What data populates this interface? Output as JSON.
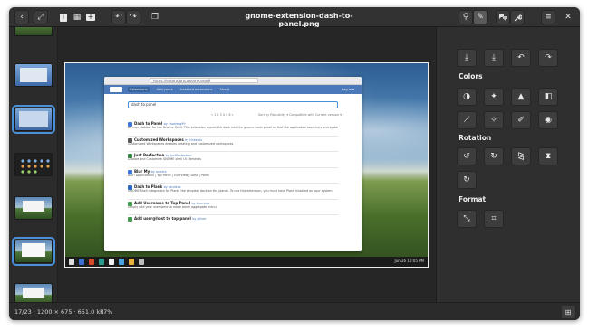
{
  "window": {
    "title": "gnome-extension-dash-to-panel.png"
  },
  "headerbar": {
    "left_buttons": [
      {
        "name": "back-icon",
        "glyph": "‹"
      },
      {
        "name": "fullscreen-icon",
        "glyph": "⤢"
      },
      {
        "name": "info-icon",
        "glyph": "i"
      },
      {
        "name": "gallery-icon",
        "glyph": "▦"
      },
      {
        "name": "add-icon",
        "glyph": "+"
      },
      {
        "name": "rotate-left-icon",
        "glyph": "↶"
      },
      {
        "name": "rotate-right-icon",
        "glyph": "↷"
      },
      {
        "name": "copy-icon",
        "glyph": "❐"
      }
    ],
    "right_buttons": [
      {
        "name": "pin-icon",
        "glyph": "⚲"
      },
      {
        "name": "edit-pencil-icon",
        "glyph": "✎"
      },
      {
        "name": "chat-icon",
        "glyph": "💬"
      },
      {
        "name": "wrench-icon",
        "glyph": "🔧"
      },
      {
        "name": "menu-icon",
        "glyph": "≡"
      }
    ],
    "close_glyph": "✕"
  },
  "browser": {
    "url": "https://extensions.gnome.org/#",
    "nav_items": [
      "Extensions",
      "Add yours",
      "Installed extensions",
      "About"
    ],
    "login": "Log in ▾",
    "search_value": "dash to panel",
    "pager": "« 1 2 3 4 5 6 »",
    "filters": "Sort by  Popularity ▾   Compatible with  Current version ▾",
    "extensions": [
      {
        "name": "Dash to Panel",
        "author": "by charlesg99",
        "desc": "An icon taskbar for the Gnome Shell. This extension moves the dash into the gnome main panel so that the application launchers and system tray are combined into a single panel, similar to that found in KDE Plasma and Windows 7+.",
        "color": "#3b7ad8"
      },
      {
        "name": "Customized Workspaces",
        "author": "by tinkeros",
        "desc": "Customized Workspaces enables creating and customized workspaces",
        "color": "#5a5a5a"
      },
      {
        "name": "Just Perfection",
        "author": "by JustPerfection",
        "desc": "Disable and Customize GNOME shell UI Elements",
        "color": "#2d8a3e"
      },
      {
        "name": "Blur My",
        "author": "by aunetx",
        "desc": "Blur: Applications | Top Panel | Overview | Dash | Panel",
        "color": "#3b7ad8"
      },
      {
        "name": "Dash to Plank",
        "author": "by tondeos",
        "desc": "GNOME Shell integration for Plank, the simplest dock on the planet. To use this extension, you must have Plank installed on your system.",
        "color": "#2a6ac8"
      },
      {
        "name": "Add Username to Top Panel",
        "author": "by tkurniaw",
        "desc": "Simply add your username to make panel aggregate menu",
        "color": "#3e9e4a"
      },
      {
        "name": "Add user@host to top panel",
        "author": "by jsilver",
        "desc": "",
        "color": "#3e9e4a"
      }
    ],
    "clock": "Jun 26   10:05 PM"
  },
  "sidepanel": {
    "top_buttons": [
      {
        "name": "save-icon",
        "glyph": "⤓"
      },
      {
        "name": "save-as-icon",
        "glyph": "⤓"
      },
      {
        "name": "undo-icon",
        "glyph": "↶"
      },
      {
        "name": "redo-icon",
        "glyph": "↷"
      }
    ],
    "colors_heading": "Colors",
    "colors_buttons": [
      {
        "name": "contrast-icon",
        "glyph": "◑"
      },
      {
        "name": "brightness-icon",
        "glyph": "✦"
      },
      {
        "name": "levels-icon",
        "glyph": "▲"
      },
      {
        "name": "saturation-icon",
        "glyph": "◧"
      },
      {
        "name": "curves-icon",
        "glyph": "⟋"
      },
      {
        "name": "magic-wand-icon",
        "glyph": "✧"
      },
      {
        "name": "eyedropper-icon",
        "glyph": "✐"
      },
      {
        "name": "red-eye-icon",
        "glyph": "◉"
      }
    ],
    "rotation_heading": "Rotation",
    "rotation_buttons": [
      {
        "name": "rotate-ccw-icon",
        "glyph": "↺"
      },
      {
        "name": "rotate-cw-icon",
        "glyph": "↻"
      },
      {
        "name": "flip-horizontal-icon",
        "glyph": "⧎"
      },
      {
        "name": "flip-vertical-icon",
        "glyph": "⧗"
      },
      {
        "name": "rotate-free-icon",
        "glyph": "↻"
      }
    ],
    "format_heading": "Format",
    "format_buttons": [
      {
        "name": "resize-icon",
        "glyph": "⤡"
      },
      {
        "name": "crop-icon",
        "glyph": "⌗"
      }
    ]
  },
  "statusbar": {
    "info": "17/23 · 1200 × 675 · 651.0 kB",
    "zoom": "77%",
    "grid_glyph": "⊞"
  }
}
